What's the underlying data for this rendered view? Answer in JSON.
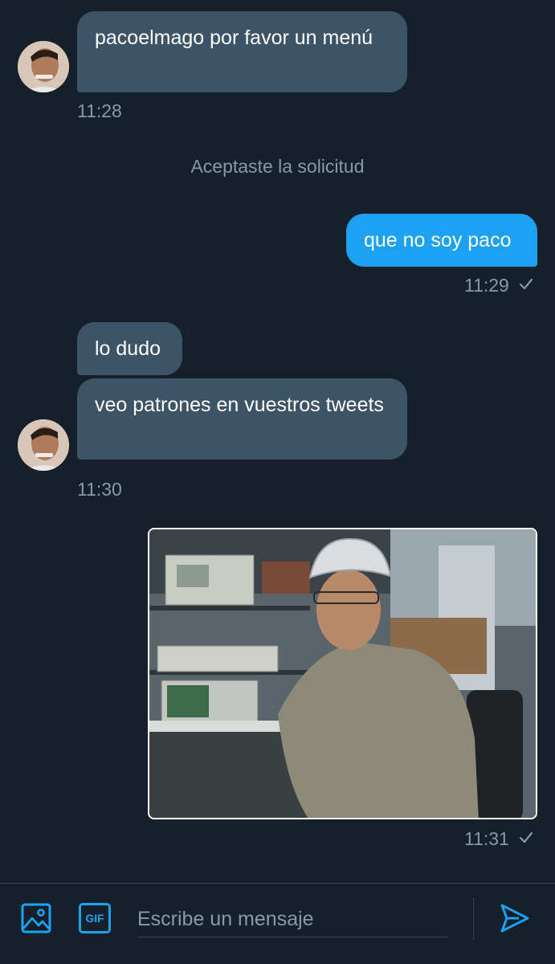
{
  "conversation": {
    "messages": [
      {
        "from": "them",
        "text": "pacoelmago por favor un menú"
      },
      {
        "from": "them_time",
        "text": "11:28"
      },
      {
        "from": "me",
        "text": "que no soy paco",
        "time": "11:29"
      },
      {
        "from": "them",
        "text": "lo dudo"
      },
      {
        "from": "them",
        "text": "veo patrones en vuestros tweets",
        "time": "11:30"
      },
      {
        "from": "me_image",
        "time": "11:31"
      }
    ],
    "system_note": "Aceptaste la solicitud"
  },
  "composer": {
    "placeholder": "Escribe un mensaje",
    "gif_label": "GIF"
  },
  "icons": {
    "image": "image-icon",
    "gif": "gif-icon",
    "send": "send-icon",
    "read_receipt": "checkmark-icon"
  },
  "colors": {
    "background": "#15202b",
    "incoming_bubble": "#3d5466",
    "outgoing_bubble": "#1da1f2",
    "muted_text": "#8899a6",
    "accent": "#1da1f2"
  }
}
